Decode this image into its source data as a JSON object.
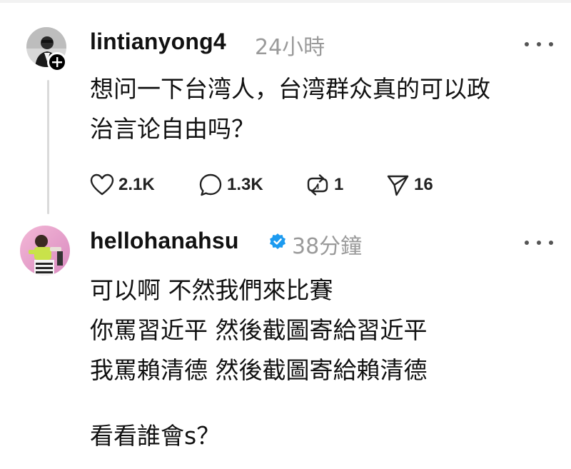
{
  "post1": {
    "username": "lintianyong4",
    "time": "24小時",
    "lines": [
      "想问一下台湾人，台湾群众真的可以政",
      "治言论自由吗？"
    ],
    "actions": {
      "likes": "2.1K",
      "comments": "1.3K",
      "reposts": "1",
      "shares": "16"
    }
  },
  "post2": {
    "username": "hellohanahsu",
    "time": "38分鐘",
    "verified": true,
    "lines": [
      "可以啊 不然我們來比賽",
      "你罵習近平 然後截圖寄給習近平",
      "我罵賴清德 然後截圖寄給賴清德",
      "",
      "看看誰會s？"
    ]
  },
  "icons": {
    "like": "heart-icon",
    "comment": "comment-icon",
    "repost": "repost-icon",
    "share": "send-icon",
    "more": "more-icon",
    "follow": "plus-icon",
    "verified": "verified-badge-icon"
  },
  "colors": {
    "text": "#111111",
    "muted": "#9a9a9a",
    "verified": "#1d9bf0",
    "thread_line": "#dadada"
  }
}
